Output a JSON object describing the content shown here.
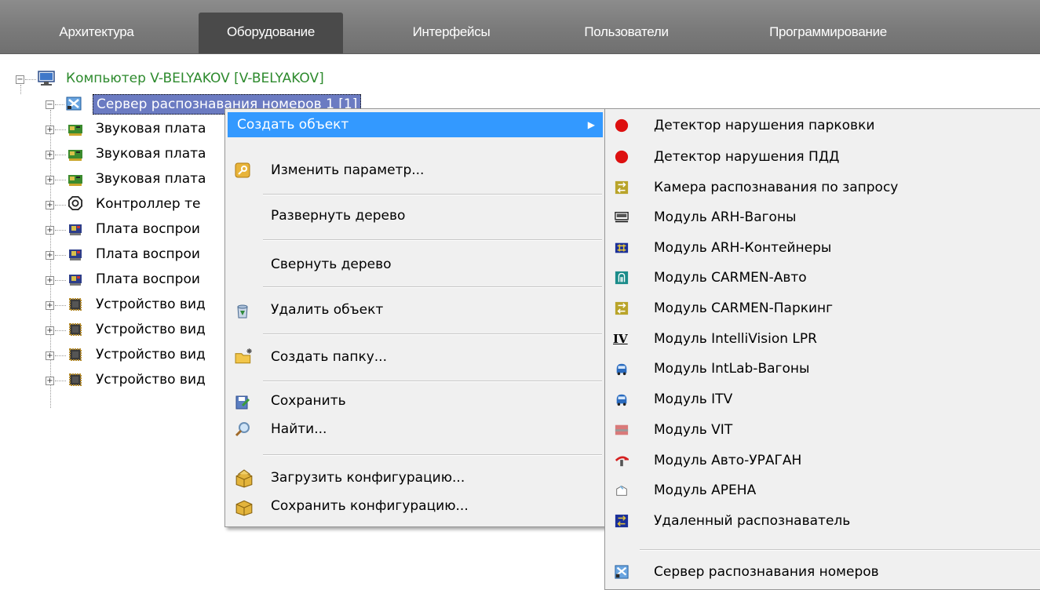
{
  "tabs": [
    {
      "label": "Архитектура",
      "active": false
    },
    {
      "label": "Оборудование",
      "active": true
    },
    {
      "label": "Интерфейсы",
      "active": false
    },
    {
      "label": "Пользователи",
      "active": false
    },
    {
      "label": "Программирование",
      "active": false
    }
  ],
  "tree": {
    "root": {
      "label": "Компьютер V-BELYAKOV [V-BELYAKOV]",
      "icon": "computer-icon",
      "color": "#2d8a2d"
    },
    "selected": {
      "label": "Сервер распознавания номеров 1 [1]",
      "icon": "recognition-server-icon"
    },
    "children": [
      {
        "label": "Звуковая плата",
        "icon": "sound-card-icon"
      },
      {
        "label": "Звуковая плата",
        "icon": "sound-card-icon"
      },
      {
        "label": "Звуковая плата",
        "icon": "sound-card-icon"
      },
      {
        "label": "Контроллер те",
        "icon": "controller-icon"
      },
      {
        "label": "Плата воспрои",
        "icon": "playback-board-icon"
      },
      {
        "label": "Плата воспрои",
        "icon": "playback-board-icon"
      },
      {
        "label": "Плата воспрои",
        "icon": "playback-board-icon"
      },
      {
        "label": "Устройство вид",
        "icon": "video-device-icon"
      },
      {
        "label": "Устройство вид",
        "icon": "video-device-icon"
      },
      {
        "label": "Устройство вид",
        "icon": "video-device-icon"
      },
      {
        "label": "Устройство вид",
        "icon": "video-device-icon"
      }
    ]
  },
  "context_menu": {
    "create_object": "Создать объект",
    "change_param": "Изменить параметр...",
    "expand_tree": "Развернуть дерево",
    "collapse_tree": "Свернуть дерево",
    "delete_object": "Удалить объект",
    "create_folder": "Создать папку...",
    "save": "Сохранить",
    "find": "Найти...",
    "load_config": "Загрузить конфигурацию...",
    "save_config": "Сохранить конфигурацию..."
  },
  "submenu": {
    "items": [
      {
        "label": "Детектор нарушения парковки",
        "icon": "red-dot-icon"
      },
      {
        "label": "Детектор нарушения ПДД",
        "icon": "red-dot-icon"
      },
      {
        "label": "Камера распознавания по запросу",
        "icon": "recognition-camera-icon"
      },
      {
        "label": "Модуль ARH-Вагоны",
        "icon": "arh-wagons-icon"
      },
      {
        "label": "Модуль ARH-Контейнеры",
        "icon": "arh-containers-icon"
      },
      {
        "label": "Модуль CARMEN-Авто",
        "icon": "carmen-auto-icon"
      },
      {
        "label": "Модуль CARMEN-Паркинг",
        "icon": "carmen-parking-icon"
      },
      {
        "label": "Модуль IntelliVision LPR",
        "icon": "intellivision-icon"
      },
      {
        "label": "Модуль IntLab-Вагоны",
        "icon": "intlab-icon"
      },
      {
        "label": "Модуль ITV",
        "icon": "itv-icon"
      },
      {
        "label": "Модуль VIT",
        "icon": "vit-icon"
      },
      {
        "label": "Модуль Авто-УРАГАН",
        "icon": "uragan-icon"
      },
      {
        "label": "Модуль АРЕНА",
        "icon": "arena-icon"
      },
      {
        "label": "Удаленный распознаватель",
        "icon": "remote-recognizer-icon"
      }
    ],
    "last_item": {
      "label": "Сервер распознавания номеров",
      "icon": "recognition-server-icon"
    }
  },
  "colors": {
    "tabbar": "#7a7a7a",
    "active_tab": "#4a4a4a",
    "selection": "#3399ff",
    "tree_root_text": "#2d8a2d",
    "menu_bg": "#f0f0f0"
  }
}
